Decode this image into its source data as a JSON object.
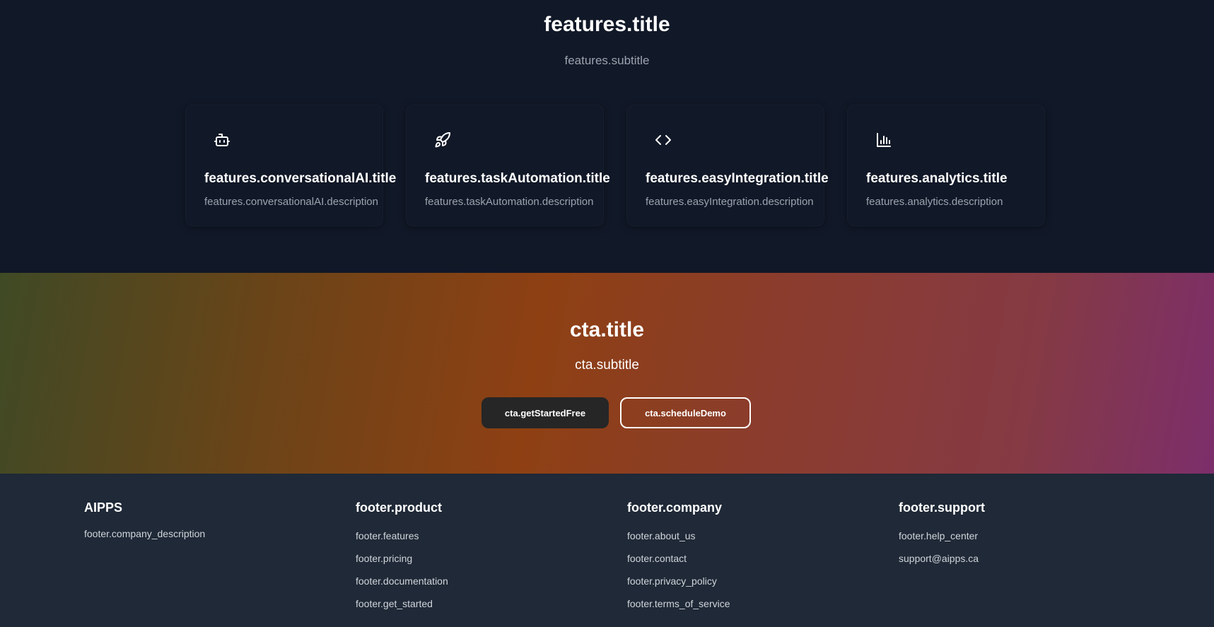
{
  "features": {
    "title": "features.title",
    "subtitle": "features.subtitle",
    "items": [
      {
        "icon": "robot-icon",
        "title": "features.conversationalAI.title",
        "description": "features.conversationalAI.description"
      },
      {
        "icon": "rocket-icon",
        "title": "features.taskAutomation.title",
        "description": "features.taskAutomation.description"
      },
      {
        "icon": "code-icon",
        "title": "features.easyIntegration.title",
        "description": "features.easyIntegration.description"
      },
      {
        "icon": "bar-chart-icon",
        "title": "features.analytics.title",
        "description": "features.analytics.description"
      }
    ]
  },
  "cta": {
    "title": "cta.title",
    "subtitle": "cta.subtitle",
    "primary_label": "cta.getStartedFree",
    "secondary_label": "cta.scheduleDemo"
  },
  "footer": {
    "brand": {
      "heading": "AIPPS",
      "description": "footer.company_description"
    },
    "columns": [
      {
        "heading": "footer.product",
        "links": [
          "footer.features",
          "footer.pricing",
          "footer.documentation",
          "footer.get_started"
        ]
      },
      {
        "heading": "footer.company",
        "links": [
          "footer.about_us",
          "footer.contact",
          "footer.privacy_policy",
          "footer.terms_of_service"
        ]
      },
      {
        "heading": "footer.support",
        "links": [
          "footer.help_center",
          "support@aipps.ca"
        ]
      }
    ]
  },
  "colors": {
    "page_bg": "#111827",
    "footer_bg": "#1f2937",
    "muted_text": "#9ca3af",
    "cta_gradient": [
      "#3f4a25",
      "#8e4013",
      "#7c2e6b"
    ],
    "primary_button": "#262626"
  }
}
